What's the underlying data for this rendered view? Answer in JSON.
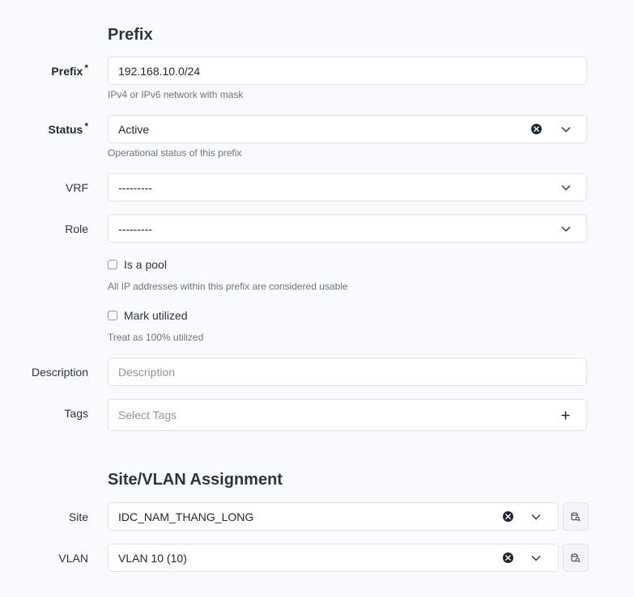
{
  "sections": {
    "prefix_title": "Prefix",
    "site_vlan_title": "Site/VLAN Assignment"
  },
  "prefix": {
    "label": "Prefix",
    "required_mark": "*",
    "value": "192.168.10.0/24",
    "help": "IPv4 or IPv6 network with mask"
  },
  "status": {
    "label": "Status",
    "required_mark": "*",
    "value": "Active",
    "help": "Operational status of this prefix"
  },
  "vrf": {
    "label": "VRF",
    "value": "---------"
  },
  "role": {
    "label": "Role",
    "value": "---------"
  },
  "is_pool": {
    "label": "Is a pool",
    "checked": false,
    "help": "All IP addresses within this prefix are considered usable"
  },
  "mark_utilized": {
    "label": "Mark utilized",
    "checked": false,
    "help": "Treat as 100% utilized"
  },
  "description": {
    "label": "Description",
    "placeholder": "Description",
    "value": ""
  },
  "tags": {
    "label": "Tags",
    "placeholder": "Select Tags"
  },
  "site": {
    "label": "Site",
    "value": "IDC_NAM_THANG_LONG"
  },
  "vlan": {
    "label": "VLAN",
    "value": "VLAN 10 (10)"
  }
}
